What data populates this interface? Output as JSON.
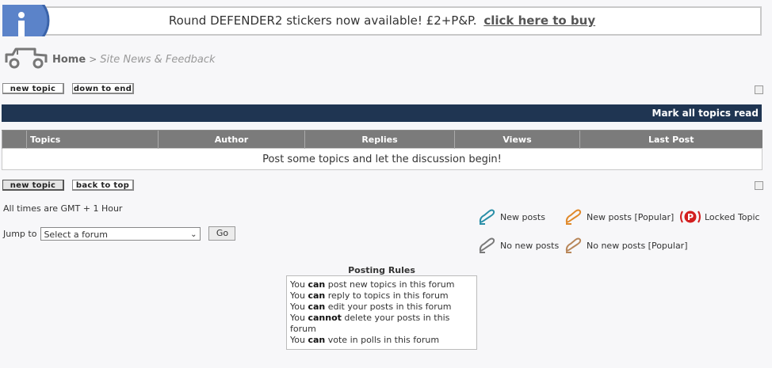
{
  "banner": {
    "message": "Round DEFENDER2 stickers now available! £2+P&P.",
    "link": "click here to buy"
  },
  "breadcrumb": {
    "home": "Home",
    "separator": ">",
    "forum": "Site News & Feedback"
  },
  "buttons": {
    "new_topic": "new topic",
    "down_to_end": "down to end",
    "back_to_top": "back to top"
  },
  "mark_all": "Mark all topics read",
  "table": {
    "columns": [
      "Topics",
      "Author",
      "Replies",
      "Views",
      "Last Post"
    ],
    "empty_message": "Post some topics and let the discussion begin!"
  },
  "footer": {
    "times": "All times are GMT + 1 Hour",
    "jump_label": "Jump to",
    "jump_selected": "Select a forum",
    "go": "Go"
  },
  "legend": {
    "new_posts": "New posts",
    "new_posts_popular": "New posts [Popular]",
    "locked": "Locked Topic",
    "no_new_posts": "No new posts",
    "no_new_posts_popular": "No new posts [Popular]"
  },
  "rules": {
    "title": "Posting Rules",
    "lines": [
      {
        "pre": "You",
        "verb": "can",
        "post": "post new topics in this forum"
      },
      {
        "pre": "You",
        "verb": "can",
        "post": "reply to topics in this forum"
      },
      {
        "pre": "You",
        "verb": "can",
        "post": "edit your posts in this forum"
      },
      {
        "pre": "You",
        "verb": "cannot",
        "post": "delete your posts in this forum"
      },
      {
        "pre": "You",
        "verb": "can",
        "post": "vote in polls in this forum"
      }
    ]
  },
  "colors": {
    "header_bar": "#1f3552",
    "table_header": "#7b7b7b",
    "icon_new": "#2a8fa8",
    "icon_popular": "#e0892a",
    "icon_locked": "#d21f1f",
    "icon_none": "#7a7a7a"
  }
}
